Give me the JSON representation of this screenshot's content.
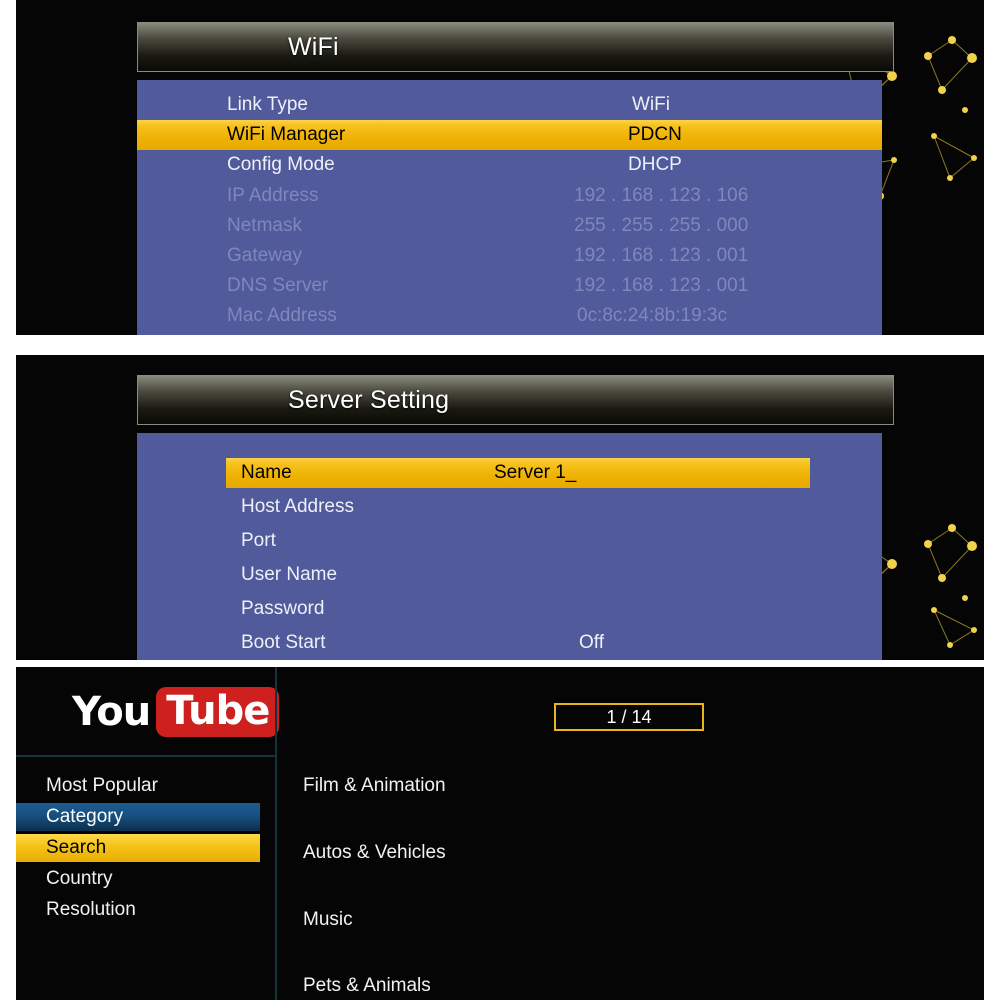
{
  "panels": {
    "wifi": {
      "title": "WiFi",
      "rows": [
        {
          "label": "Link Type",
          "value": "WiFi",
          "state": "normal"
        },
        {
          "label": "WiFi Manager",
          "value": "PDCN",
          "state": "highlighted"
        },
        {
          "label": "Config Mode",
          "value": "DHCP",
          "state": "normal"
        },
        {
          "label": "IP Address",
          "value": "192 . 168 . 123 . 106",
          "state": "disabled"
        },
        {
          "label": "Netmask",
          "value": "255 . 255 . 255 . 000",
          "state": "disabled"
        },
        {
          "label": "Gateway",
          "value": "192 . 168 . 123 . 001",
          "state": "disabled"
        },
        {
          "label": "DNS Server",
          "value": "192 . 168 . 123 . 001",
          "state": "disabled"
        },
        {
          "label": "Mac Address",
          "value": "0c:8c:24:8b:19:3c",
          "state": "disabled"
        }
      ]
    },
    "server": {
      "title": "Server Setting",
      "rows": [
        {
          "label": "Name",
          "value": "Server 1_",
          "state": "highlighted"
        },
        {
          "label": "Host Address",
          "value": "",
          "state": "normal"
        },
        {
          "label": "Port",
          "value": "",
          "state": "normal"
        },
        {
          "label": "User Name",
          "value": "",
          "state": "normal"
        },
        {
          "label": "Password",
          "value": "",
          "state": "normal"
        },
        {
          "label": "Boot Start",
          "value": "Off",
          "state": "normal"
        }
      ]
    },
    "youtube": {
      "logo": {
        "word1": "You",
        "word2": "Tube"
      },
      "page_indicator": "1 / 14",
      "menu": [
        {
          "label": "Most Popular",
          "state": "normal"
        },
        {
          "label": "Category",
          "state": "selected-blue"
        },
        {
          "label": "Search",
          "state": "selected-gold"
        },
        {
          "label": "Country",
          "state": "normal"
        },
        {
          "label": "Resolution",
          "state": "normal"
        }
      ],
      "categories": [
        "Film & Animation",
        "Autos & Vehicles",
        "Music",
        "Pets & Animals"
      ]
    }
  },
  "colors": {
    "panel_blue": "#515a9b",
    "highlight_gold": "#eeb103",
    "highlight_blue": "#16507f",
    "youtube_red": "#cd201f",
    "disabled_text": "#7f87bd",
    "divider_teal": "#14343d"
  }
}
